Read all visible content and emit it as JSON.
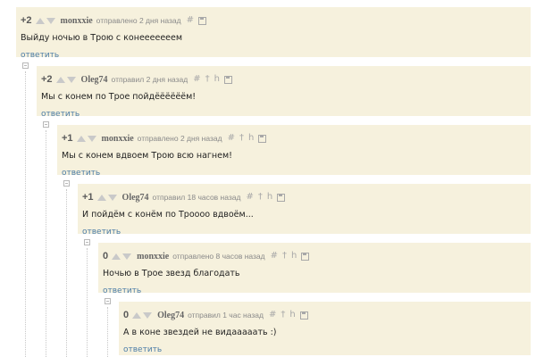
{
  "comments": [
    {
      "score": "+2",
      "author": "monxxie",
      "meta": "отправлено 2 дня назад",
      "text": "Выйду ночью в Трою с конееееееем",
      "reply_label": "ответить"
    },
    {
      "score": "+2",
      "author": "Oleg74",
      "meta": "отправил 2 дня назад",
      "text": "Мы с конем по Трое пойдёёёёёём!",
      "reply_label": "ответить"
    },
    {
      "score": "+1",
      "author": "monxxie",
      "meta": "отправлено 2 дня назад",
      "text": "Мы с конем вдвоем Трою всю нагнем!",
      "reply_label": "ответить"
    },
    {
      "score": "+1",
      "author": "Oleg74",
      "meta": "отправил 18 часов назад",
      "text": "И пойдём с конём по Троооо вдвоём...",
      "reply_label": "ответить"
    },
    {
      "score": "0",
      "author": "monxxie",
      "meta": "отправлено 8 часов назад",
      "text": "Ночью в Трое звезд благодать",
      "reply_label": "ответить"
    },
    {
      "score": "0",
      "author": "Oleg74",
      "meta": "отправил 1 час назад",
      "text": "А в коне звездей не видааааать :)",
      "reply_label": "ответить"
    }
  ],
  "icons": {
    "hash": "#",
    "dagger": "†",
    "h": "h"
  },
  "colors": {
    "comment_bg": "#f6f1dd",
    "link": "#4d7ea8",
    "vote_arrow": "#c9c9c9"
  }
}
